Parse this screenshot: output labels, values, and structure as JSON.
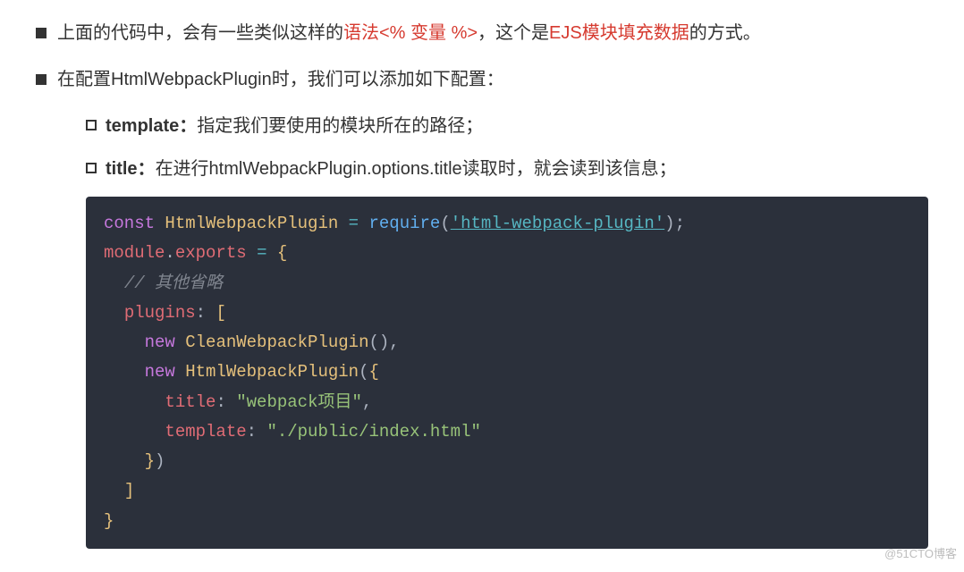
{
  "bullet1": {
    "pre": "上面的代码中，会有一些类似这样的",
    "red1": "语法<% 变量 %>",
    "mid": "，这个是",
    "red2": "EJS模块填充数据",
    "post": "的方式。"
  },
  "bullet2": "在配置HtmlWebpackPlugin时，我们可以添加如下配置：",
  "sub1": {
    "label": "template：",
    "text": "指定我们要使用的模块所在的路径；"
  },
  "sub2": {
    "label": "title：",
    "text": "在进行htmlWebpackPlugin.options.title读取时，就会读到该信息；"
  },
  "code": {
    "kw_const": "const",
    "cls_html": "HtmlWebpackPlugin",
    "fn_require": "require",
    "str_pkg": "'html-webpack-plugin'",
    "var_module": "module",
    "prop_exports": "exports",
    "comment": "// 其他省略",
    "prop_plugins": "plugins",
    "kw_new1": "new",
    "cls_clean": "CleanWebpackPlugin",
    "kw_new2": "new",
    "cls_html2": "HtmlWebpackPlugin",
    "prop_title": "title",
    "str_title": "\"webpack项目\"",
    "prop_template": "template",
    "str_template": "\"./public/index.html\""
  },
  "watermark": "@51CTO博客"
}
